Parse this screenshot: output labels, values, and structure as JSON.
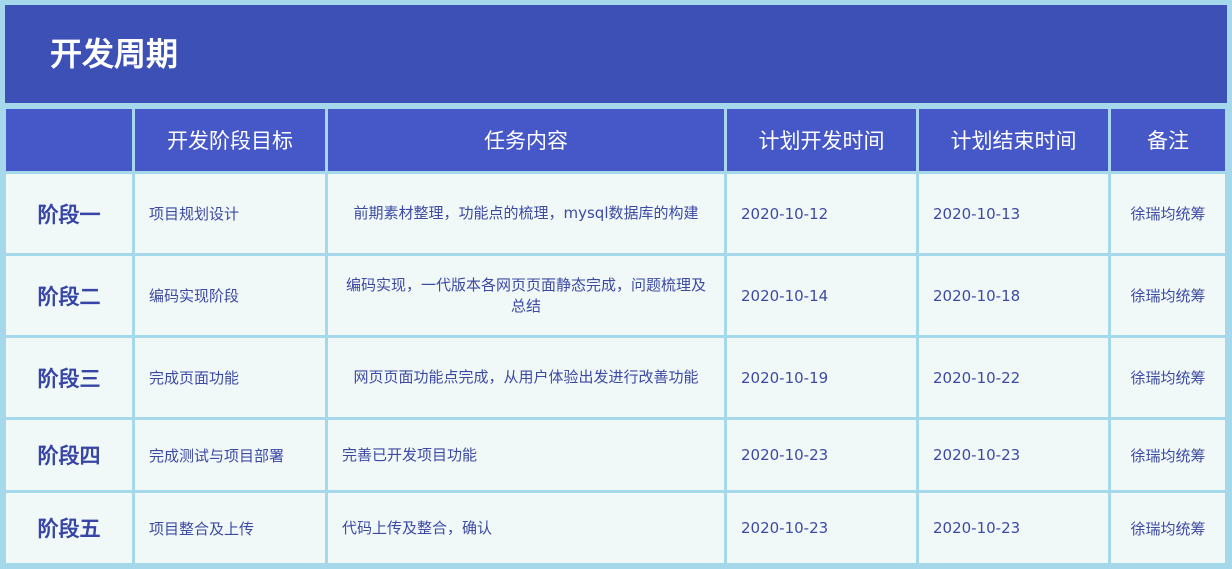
{
  "title": "开发周期",
  "headers": [
    "",
    "开发阶段目标",
    "任务内容",
    "计划开发时间",
    "计划结束时间",
    "备注"
  ],
  "rows": [
    {
      "stage": "阶段一",
      "goal": "项目规划设计",
      "task": "前期素材整理，功能点的梳理，mysql数据库的构建",
      "start": "2020-10-12",
      "end": "2020-10-13",
      "note": "徐瑞均统筹"
    },
    {
      "stage": "阶段二",
      "goal": "编码实现阶段",
      "task": "编码实现，一代版本各网页页面静态完成，问题梳理及总结",
      "start": "2020-10-14",
      "end": "2020-10-18",
      "note": "徐瑞均统筹"
    },
    {
      "stage": "阶段三",
      "goal": "完成页面功能",
      "task": "网页页面功能点完成，从用户体验出发进行改善功能",
      "start": "2020-10-19",
      "end": "2020-10-22",
      "note": "徐瑞均统筹"
    },
    {
      "stage": "阶段四",
      "goal": "完成测试与项目部署",
      "task": "完善已开发项目功能",
      "start": "2020-10-23",
      "end": "2020-10-23",
      "note": "徐瑞均统筹"
    },
    {
      "stage": "阶段五",
      "goal": "项目整合及上传",
      "task": "代码上传及整合，确认",
      "start": "2020-10-23",
      "end": "2020-10-23",
      "note": "徐瑞均统筹"
    }
  ],
  "colors": {
    "title_bg": "#3d50b6",
    "header_bg": "#4658c8",
    "cell_bg": "#f1f8f8",
    "border": "#a4d8ea",
    "text": "#3d4aa4"
  }
}
